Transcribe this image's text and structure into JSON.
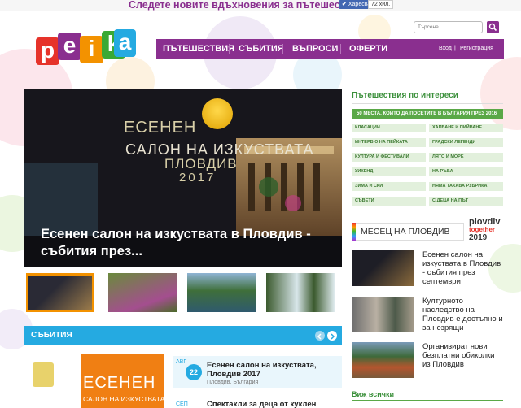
{
  "promo": {
    "text": "Следете новите вдъхновения за пътешествия!",
    "like_label": "Харесвам",
    "like_count": "72 хил."
  },
  "logo": {
    "letters": [
      "p",
      "e",
      "i",
      "k",
      "a"
    ],
    "colors": [
      "#e6332a",
      "#8a2f8f",
      "#f39200",
      "#3aa935",
      "#25aae1"
    ]
  },
  "search": {
    "placeholder": "Търсене"
  },
  "nav": {
    "items": [
      "ПЪТЕШЕСТВИЯ",
      "СЪБИТИЯ",
      "ВЪПРОСИ",
      "ОФЕРТИ"
    ],
    "login": "Вход",
    "register": "Регистрация"
  },
  "hero": {
    "title_line1": "ЕСЕНЕН",
    "title_line2": "САЛОН НА ИЗКУСТВАТА",
    "title_line3": "ПЛОВДИВ",
    "title_line4": "2017",
    "caption": "Есенен салон на изкуствата в Пловдив - събития през..."
  },
  "events": {
    "title": "СЪБИТИЯ",
    "banner_line1": "ЕСЕНЕН",
    "banner_line2": "САЛОН НА ИЗКУСТВАТА",
    "items": [
      {
        "month": "АВГ",
        "day": "22",
        "title": "Есенен салон на изкуствата, Пловдив 2017",
        "location": "Пловдив, България"
      },
      {
        "month": "СЕП",
        "day": "",
        "title": "Спектакли за деца от куклен театър",
        "location": ""
      }
    ]
  },
  "sidebar": {
    "title": "Пътешествия по интереси",
    "top_link": "50 МЕСТА, КОИТО ДА ПОСЕТИТЕ В БЪЛГАРИЯ ПРЕЗ 2016",
    "tags": [
      "КЛАСАЦИИ",
      "ХАПВАНЕ И ПИЙВАНЕ",
      "ИНТЕРВЮ НА ПЕЙКАТА",
      "ГРАДСКИ ЛЕГЕНДИ",
      "КУЛТУРА И ФЕСТИВАЛИ",
      "ЛЯТО И МОРЕ",
      "УИКЕНД",
      "НА РЪБА",
      "ЗИМА И СКИ",
      "НЯМА ТАКАВА РУБРИКА",
      "СЪВЕТИ",
      "С ДЕЦА НА ПЪТ"
    ],
    "month_label": "МЕСЕЦ НА ПЛОВДИВ",
    "plovdiv_logo_line1": "plovdiv",
    "plovdiv_logo_line2": "together",
    "plovdiv_logo_year": "2019",
    "articles": [
      "Есенен салон на изкуствата в Пловдив - събития през септември",
      "Културното наследство на Пловдив е достъпно и за незрящи",
      "Организират нови безплатни обиколки из Пловдив"
    ],
    "see_all": "Виж всички"
  }
}
